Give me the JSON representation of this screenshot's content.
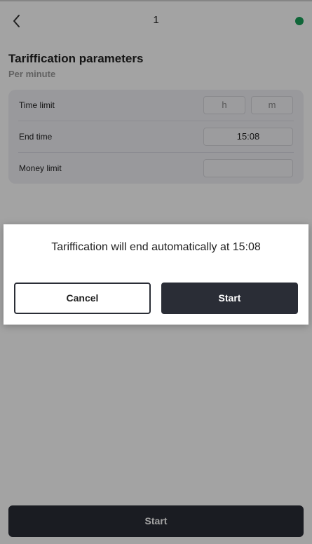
{
  "header": {
    "title": "1",
    "back_icon": "chevron-left-icon",
    "status_color": "#1aa05a"
  },
  "tariffication": {
    "title": "Tariffication parameters",
    "mode": "Per minute",
    "time_limit": {
      "label": "Time limit",
      "hours_placeholder": "h",
      "minutes_placeholder": "m"
    },
    "end_time": {
      "label": "End time",
      "value": "15:08"
    },
    "money_limit": {
      "label": "Money limit",
      "value": ""
    }
  },
  "footer": {
    "start_label": "Start"
  },
  "dialog": {
    "message": "Tariffication will end automatically at 15:08",
    "cancel_label": "Cancel",
    "start_label": "Start"
  },
  "colors": {
    "primary_dark": "#2a2d36",
    "card_background": "#efeff5"
  }
}
